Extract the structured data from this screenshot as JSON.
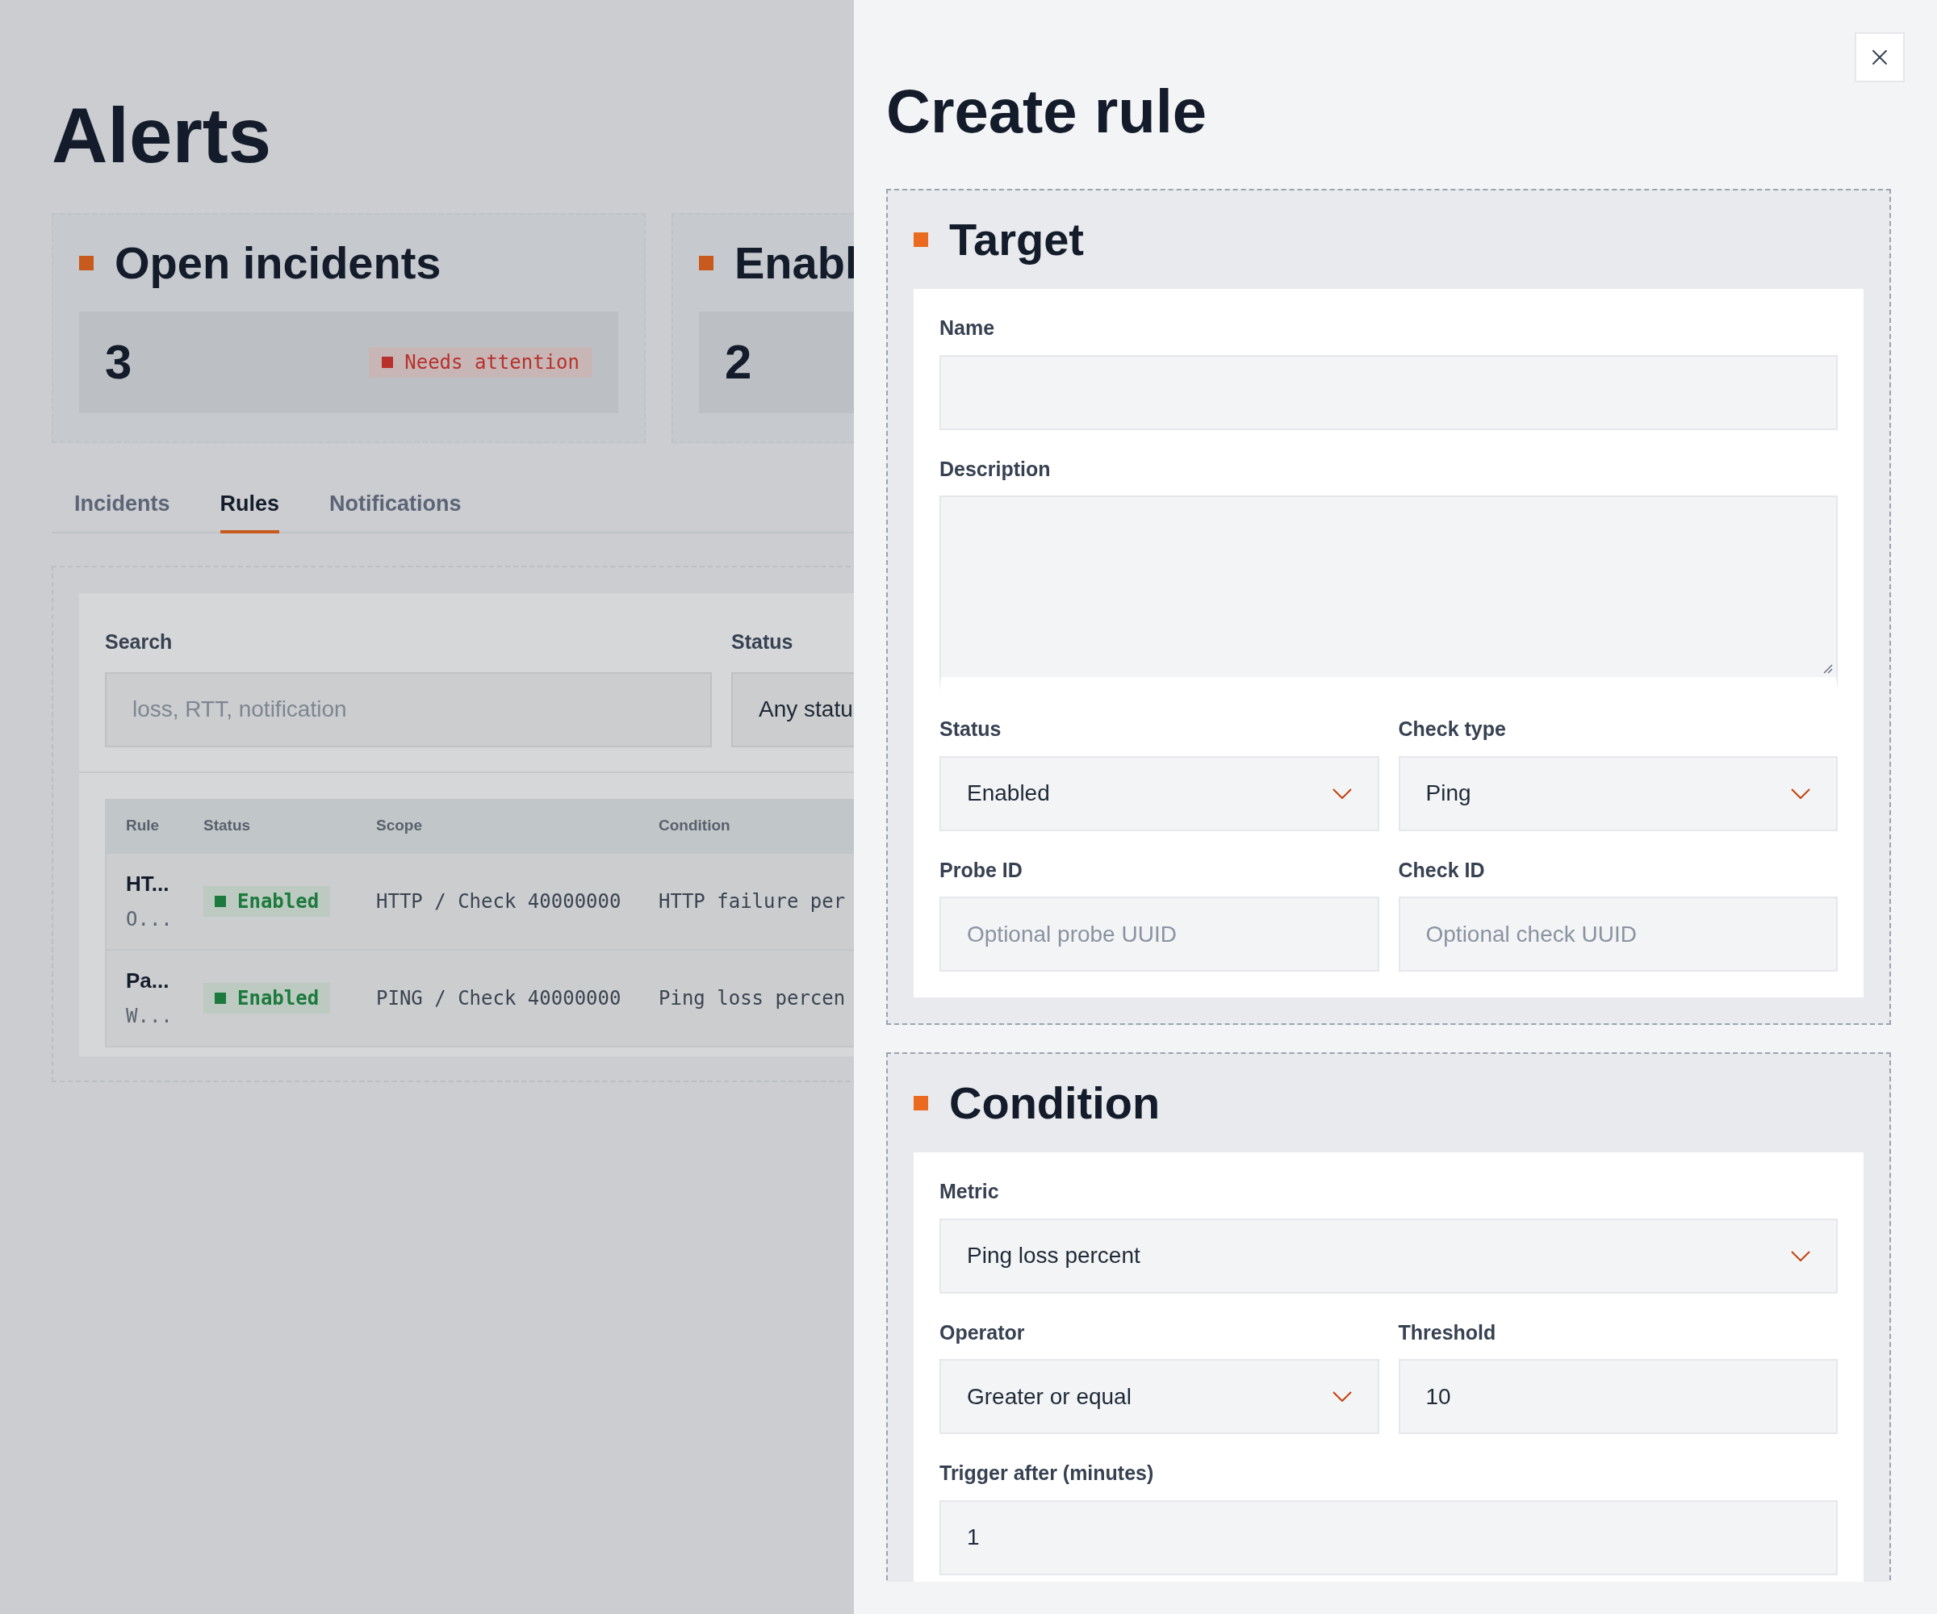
{
  "page": {
    "title": "Alerts"
  },
  "cards": [
    {
      "title": "Open incidents",
      "value": "3",
      "badge": {
        "text": "Needs attention",
        "color": "#b8312b"
      }
    },
    {
      "title": "Enabl",
      "value": "2"
    }
  ],
  "tabs": [
    {
      "label": "Incidents",
      "selected": false
    },
    {
      "label": "Rules",
      "selected": true
    },
    {
      "label": "Notifications",
      "selected": false
    }
  ],
  "filters": {
    "search": {
      "label": "Search",
      "placeholder": "loss, RTT, notification"
    },
    "status": {
      "label": "Status",
      "value": "Any statu"
    }
  },
  "table": {
    "columns": [
      "Rule",
      "Status",
      "Scope",
      "Condition"
    ],
    "rows": [
      {
        "rule": "HT...",
        "note": "O...",
        "status": "Enabled",
        "color": "#1b7a3c",
        "scope": "HTTP / Check 40000000",
        "condition": "HTTP failure per"
      },
      {
        "rule": "Pa...",
        "note": "W...",
        "status": "Enabled",
        "color": "#1b7a3c",
        "scope": "PING / Check 40000000",
        "condition": "Ping loss percen"
      }
    ]
  },
  "drawer": {
    "title": "Create rule",
    "sections": [
      {
        "title": "Target",
        "rows": [
          [
            {
              "kind": "input",
              "label": "Name"
            }
          ],
          [
            {
              "kind": "textarea",
              "label": "Description"
            }
          ],
          [
            {
              "kind": "select",
              "label": "Status",
              "value": "Enabled"
            },
            {
              "kind": "select",
              "label": "Check type",
              "value": "Ping"
            }
          ],
          [
            {
              "kind": "input",
              "label": "Probe ID",
              "placeholder": "Optional probe UUID"
            },
            {
              "kind": "input",
              "label": "Check ID",
              "placeholder": "Optional check UUID"
            }
          ]
        ]
      },
      {
        "title": "Condition",
        "rows": [
          [
            {
              "kind": "select",
              "label": "Metric",
              "value": "Ping loss percent"
            }
          ],
          [
            {
              "kind": "select",
              "label": "Operator",
              "value": "Greater or equal"
            },
            {
              "kind": "input",
              "label": "Threshold",
              "value": "10"
            }
          ],
          [
            {
              "kind": "input",
              "label": "Trigger after (minutes)",
              "value": "1"
            }
          ]
        ]
      }
    ]
  }
}
